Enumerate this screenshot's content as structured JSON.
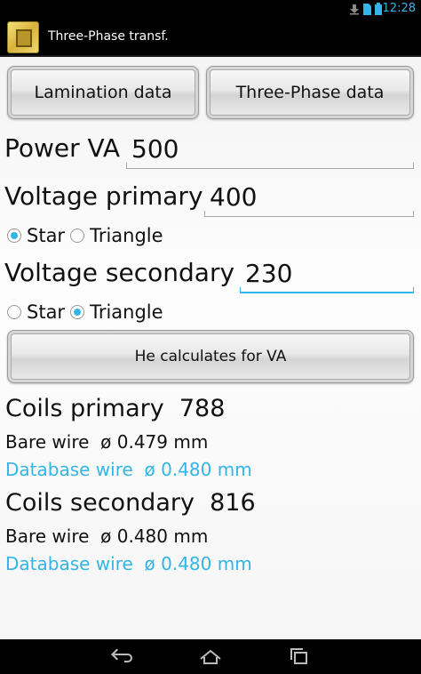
{
  "status": {
    "time": "12:28",
    "icons": [
      "download-icon",
      "sim-icon",
      "battery-icon"
    ]
  },
  "app": {
    "title": "Three-Phase transf.",
    "icon": "transformer-core-icon"
  },
  "buttons": {
    "lamination": "Lamination data",
    "three_phase": "Three-Phase data",
    "calculate": "He calculates for VA"
  },
  "power": {
    "label": "Power VA",
    "value": "500"
  },
  "voltage_primary": {
    "label": "Voltage primary",
    "value": "400",
    "options": [
      "Star",
      "Triangle"
    ],
    "selected": "Star"
  },
  "voltage_secondary": {
    "label": "Voltage secondary",
    "value": "230",
    "options": [
      "Star",
      "Triangle"
    ],
    "selected": "Triangle"
  },
  "results": {
    "primary": {
      "label": "Coils primary",
      "value": "788",
      "bare_label": "Bare wire",
      "bare_value": "ø 0.479 mm",
      "db_label": "Database wire",
      "db_value": "ø 0.480 mm"
    },
    "secondary": {
      "label": "Coils secondary",
      "value": "816",
      "bare_label": "Bare wire",
      "bare_value": "ø 0.480 mm",
      "db_label": "Database wire",
      "db_value": "ø 0.480 mm"
    }
  },
  "colors": {
    "accent": "#33b5e5",
    "text": "#111111"
  },
  "nav": [
    "back-icon",
    "home-icon",
    "recents-icon"
  ]
}
